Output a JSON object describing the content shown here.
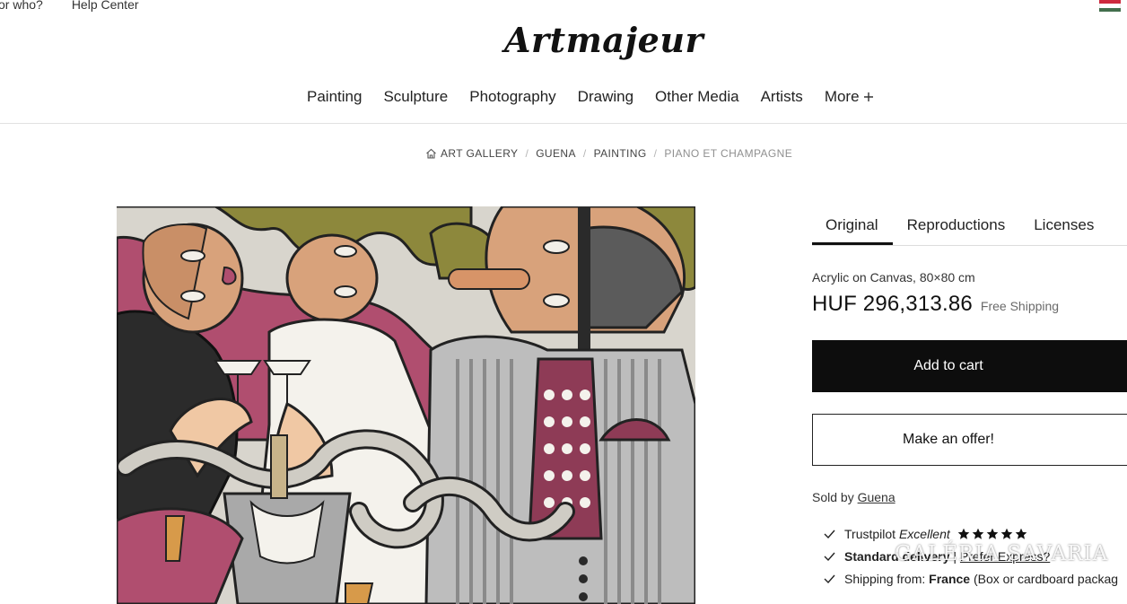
{
  "top_links": [
    "or who?",
    "Help Center"
  ],
  "logo": "Artmajeur",
  "nav": {
    "items": [
      "Painting",
      "Sculpture",
      "Photography",
      "Drawing",
      "Other Media",
      "Artists"
    ],
    "more_label": "More",
    "more_icon": "plus-icon"
  },
  "breadcrumb": {
    "home_icon": "home-icon",
    "items": [
      "ART GALLERY",
      "GUENA",
      "PAINTING"
    ],
    "current": "PIANO ET CHAMPAGNE",
    "separator": "/"
  },
  "artwork": {
    "colors": {
      "background": "#d9d6cf",
      "magenta": "#b24f70",
      "olive": "#8f8a3e",
      "skin": "#d9a37c",
      "dark": "#2a2a2a"
    }
  },
  "tabs": [
    {
      "label": "Original",
      "active": true
    },
    {
      "label": "Reproductions",
      "active": false
    },
    {
      "label": "Licenses",
      "active": false
    }
  ],
  "product": {
    "medium": "Acrylic on Canvas, 80×80 cm",
    "price": "HUF 296,313.86",
    "shipping_note": "Free Shipping",
    "add_to_cart_label": "Add to cart",
    "make_offer_label": "Make an offer!",
    "sold_by_label": "Sold by",
    "seller": "Guena"
  },
  "features": {
    "trustpilot": {
      "name": "Trustpilot",
      "rating": "Excellent",
      "stars": 5
    },
    "delivery": {
      "standard": "Standard delivery",
      "separator": "|",
      "express": "Prefer Express?"
    },
    "shipping": {
      "label": "Shipping from:",
      "country": "France",
      "packaging": "(Box or cardboard packag"
    }
  },
  "watermark": "GALÉRIA SAVARIA",
  "colors": {
    "button_black": "#0d0d0d",
    "text_dark": "#1c1c1c",
    "muted": "#6a6a6a",
    "flag": [
      "#cd2a3e",
      "#ffffff",
      "#436f4d"
    ]
  }
}
